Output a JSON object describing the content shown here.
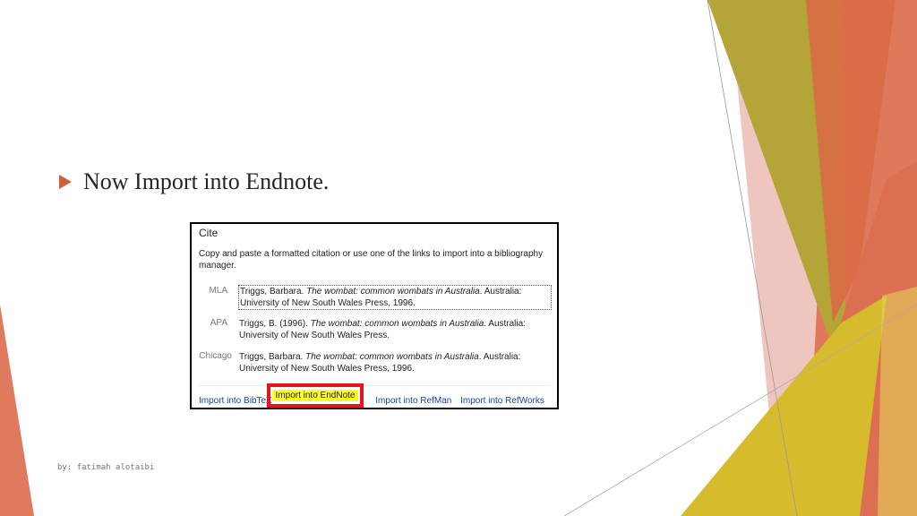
{
  "slide": {
    "bullet_text": "Now Import into Endnote.",
    "footer": "by: fatimah alotaibi"
  },
  "colors": {
    "accent": "#d0623a",
    "olive": "#b3a435",
    "gold": "#d7bd2e",
    "salmon": "#e07a5c",
    "pink": "#ebb5ad"
  },
  "cite_panel": {
    "title": "Cite",
    "intro": "Copy and paste a formatted citation or use one of the links to import into a bibliography manager.",
    "citations": [
      {
        "style": "MLA",
        "author": "Triggs, Barbara. ",
        "book_title": "The wombat: common wombats in Australia",
        "rest": ". Australia: University of New South Wales Press, 1996."
      },
      {
        "style": "APA",
        "author": "Triggs, B. (1996). ",
        "book_title": "The wombat: common wombats in Australia",
        "rest": ". Australia: University of New South Wales Press."
      },
      {
        "style": "Chicago",
        "author": "Triggs, Barbara. ",
        "book_title": "The wombat: common wombats in Australia",
        "rest": ". Australia: University of New South Wales Press, 1996."
      }
    ],
    "links": {
      "bibtex": "Import into BibTeX",
      "endnote": "Import into EndNote",
      "refman": "Import into RefMan",
      "refworks": "Import into RefWorks"
    }
  }
}
